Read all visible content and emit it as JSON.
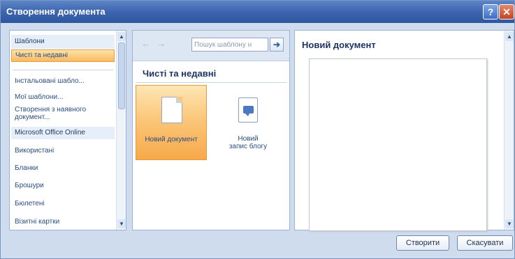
{
  "window": {
    "title": "Створення документа",
    "help_label": "?",
    "close_label": "✕"
  },
  "sidebar": {
    "items": [
      {
        "label": "Шаблони"
      },
      {
        "label": "Чисті та недавні"
      },
      {
        "label": "Інстальовані шабло..."
      },
      {
        "label": "Мої шаблони..."
      },
      {
        "label": "Створення з наявного документ..."
      },
      {
        "label": "Microsoft Office Online"
      },
      {
        "label": "Використані"
      },
      {
        "label": "Бланки"
      },
      {
        "label": "Брошури"
      },
      {
        "label": "Бюлетені"
      },
      {
        "label": "Візитні картки"
      }
    ]
  },
  "navigation": {
    "back_icon": "←",
    "forward_icon": "→",
    "search_placeholder": "Пошук шаблону н",
    "search_go_icon": "➔"
  },
  "middle": {
    "header": "Чисті та недавні",
    "tiles": [
      {
        "label": "Новий документ",
        "icon": "blank-document-icon"
      },
      {
        "label": "Новий запис блогу",
        "icon": "blog-post-icon"
      }
    ]
  },
  "preview": {
    "title": "Новий документ"
  },
  "buttons": {
    "create": "Створити",
    "cancel": "Скасувати"
  },
  "colors": {
    "titlebar": "#3a63ad",
    "selection": "#f9b960",
    "dialog_bg": "#cfdcee"
  }
}
